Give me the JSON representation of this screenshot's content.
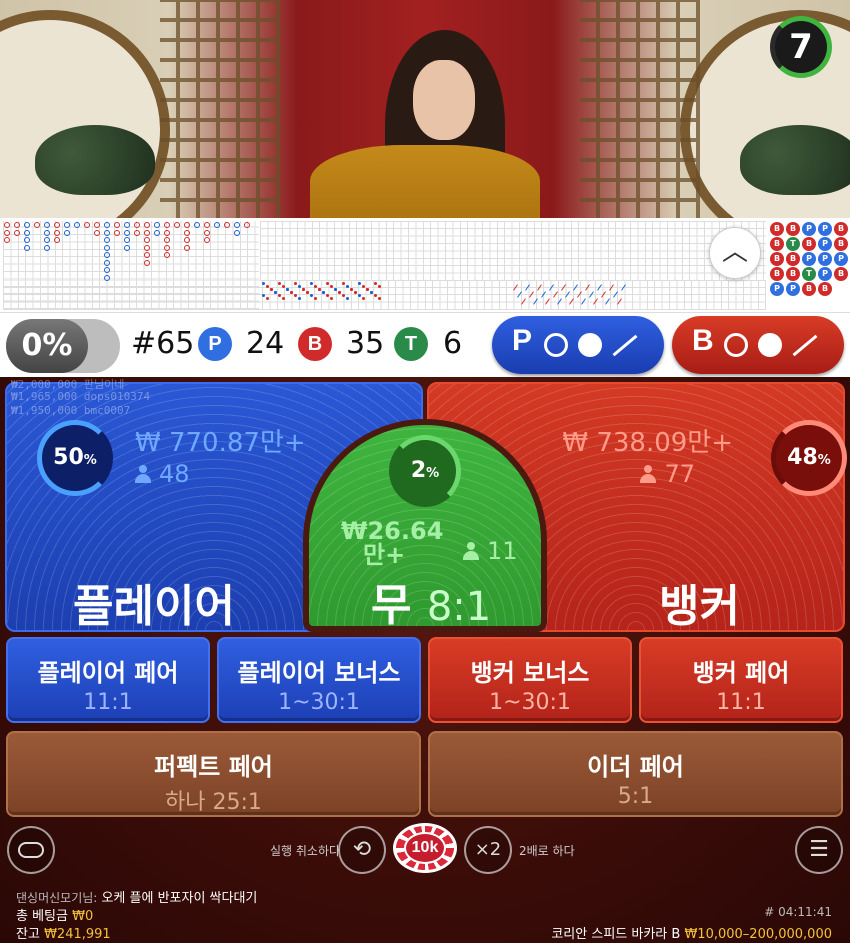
{
  "timer": "7",
  "stats": {
    "percent_toggle": "0%",
    "round": "#65",
    "player_badge": "P",
    "player_count": "24",
    "banker_badge": "B",
    "banker_count": "35",
    "tie_badge": "T",
    "tie_count": "6",
    "predict_player": "P",
    "predict_banker": "B"
  },
  "recent_bets": [
    "₩2,000,000 판님이네",
    "₩1,965,000 dops010374",
    "₩1,950,000 bmc0007"
  ],
  "player": {
    "label": "플레이어",
    "percent": "50",
    "percent_sign": "%",
    "amount": "₩ 770.87만+",
    "players": "48"
  },
  "banker": {
    "label": "뱅커",
    "percent": "48",
    "percent_sign": "%",
    "amount": "₩ 738.09만+",
    "players": "77"
  },
  "tie": {
    "label": "무",
    "odds": "8:1",
    "percent": "2",
    "percent_sign": "%",
    "amount_line1": "₩26.64",
    "amount_line2": "만+",
    "players": "11"
  },
  "side_bets": [
    {
      "title": "플레이어 페어",
      "odds": "11:1"
    },
    {
      "title": "플레이어 보너스",
      "odds": "1~30:1"
    },
    {
      "title": "뱅커 보너스",
      "odds": "1~30:1"
    },
    {
      "title": "뱅커 페어",
      "odds": "11:1"
    },
    {
      "title": "퍼펙트 페어",
      "odds": "하나 25:1"
    },
    {
      "title": "이더 페어",
      "odds": "5:1"
    }
  ],
  "controls": {
    "undo_label": "실행 취소하다",
    "chip_value": "10k",
    "double_symbol": "×2",
    "double_label": "2배로 하다"
  },
  "footer": {
    "chat_user": "댄싱머신모기님:",
    "chat_message": "오케 플에 반포자이 싹다대기",
    "total_bet_label": "총 베팅금",
    "total_bet_value": "₩0",
    "balance_label": "잔고",
    "balance_value": "₩241,991",
    "game_id": "# 04:11:41",
    "table_name": "코리안 스피드 바카라 B",
    "limits": "₩10,000–200,000,000"
  },
  "colors": {
    "player_blue": "#1d3fb5",
    "banker_red": "#b5231a",
    "tie_green": "#3fb53f",
    "highlight_yellow": "#f3c23a"
  }
}
